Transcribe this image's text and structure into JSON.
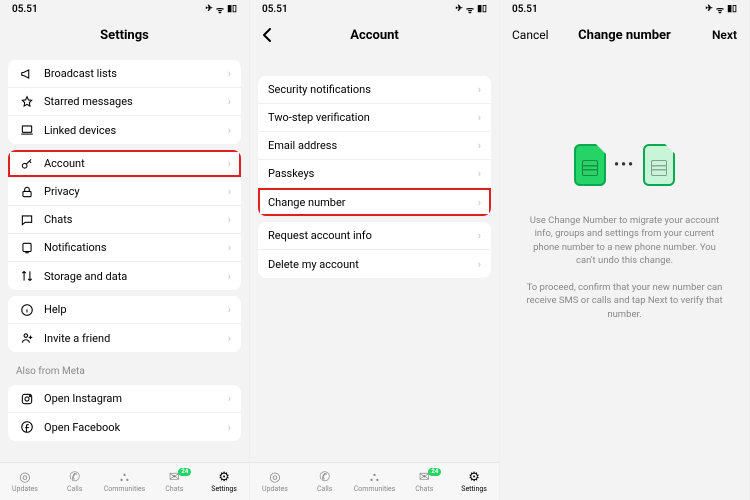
{
  "status": {
    "time": "05.51",
    "plane": "✈︎",
    "wifi": "ᯤ",
    "battery": "▮▯"
  },
  "screen1": {
    "title": "Settings",
    "g1": [
      {
        "icon": "megaphone",
        "label": "Broadcast lists"
      },
      {
        "icon": "star",
        "label": "Starred messages"
      },
      {
        "icon": "laptop",
        "label": "Linked devices"
      }
    ],
    "g2": [
      {
        "icon": "key",
        "label": "Account",
        "hl": true
      },
      {
        "icon": "lock",
        "label": "Privacy"
      },
      {
        "icon": "chat",
        "label": "Chats"
      },
      {
        "icon": "bell",
        "label": "Notifications"
      },
      {
        "icon": "arrows",
        "label": "Storage and data"
      }
    ],
    "g3": [
      {
        "icon": "info",
        "label": "Help"
      },
      {
        "icon": "person",
        "label": "Invite a friend"
      }
    ],
    "meta_label": "Also from Meta",
    "g4": [
      {
        "icon": "instagram",
        "label": "Open Instagram"
      },
      {
        "icon": "facebook",
        "label": "Open Facebook"
      }
    ]
  },
  "screen2": {
    "title": "Account",
    "g1": [
      {
        "label": "Security notifications"
      },
      {
        "label": "Two-step verification"
      },
      {
        "label": "Email address"
      },
      {
        "label": "Passkeys"
      },
      {
        "label": "Change number",
        "hl": true
      }
    ],
    "g2": [
      {
        "label": "Request account info"
      },
      {
        "label": "Delete my account"
      }
    ]
  },
  "screen3": {
    "cancel": "Cancel",
    "title": "Change number",
    "next": "Next",
    "p1": "Use Change Number to migrate your account info, groups and settings from your current phone number to a new phone number. You can't undo this change.",
    "p2": "To proceed, confirm that your new number can receive SMS or calls and tap Next to verify that number."
  },
  "tabs": [
    {
      "icon": "◎",
      "label": "Updates"
    },
    {
      "icon": "✆",
      "label": "Calls"
    },
    {
      "icon": "⛬",
      "label": "Communities"
    },
    {
      "icon": "✉",
      "label": "Chats",
      "badge": "24"
    },
    {
      "icon": "⚙",
      "label": "Settings",
      "active": true
    }
  ]
}
